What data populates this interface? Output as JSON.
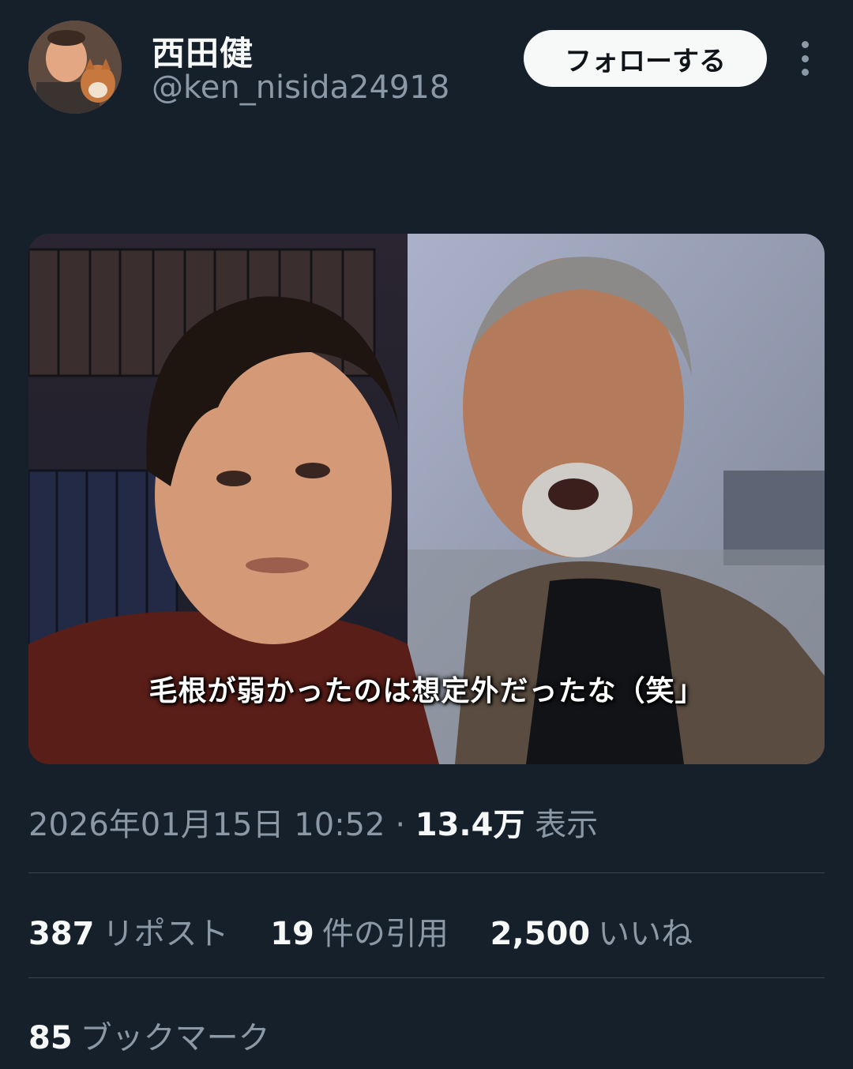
{
  "user": {
    "display_name": "西田健",
    "handle": "@ken_nisida24918",
    "follow_label": "フォローする",
    "more_icon": "more-vertical-icon"
  },
  "post": {
    "image_caption": "毛根が弱かったのは想定外だったな（笑」",
    "date_time": "2026年01月15日 10:52",
    "separator": "·",
    "views_count": "13.4万",
    "views_label": "表示"
  },
  "stats": {
    "reposts_count": "387",
    "reposts_label": "リポスト",
    "quotes_count": "19",
    "quotes_label": "件の引用",
    "likes_count": "2,500",
    "likes_label": "いいね",
    "bookmarks_count": "85",
    "bookmarks_label": "ブックマーク"
  },
  "colors": {
    "background": "#15202b",
    "primary_text": "#f7f9f9",
    "secondary_text": "#8b98a5",
    "divider": "#38444d",
    "follow_button_bg": "#f7f9f9"
  }
}
